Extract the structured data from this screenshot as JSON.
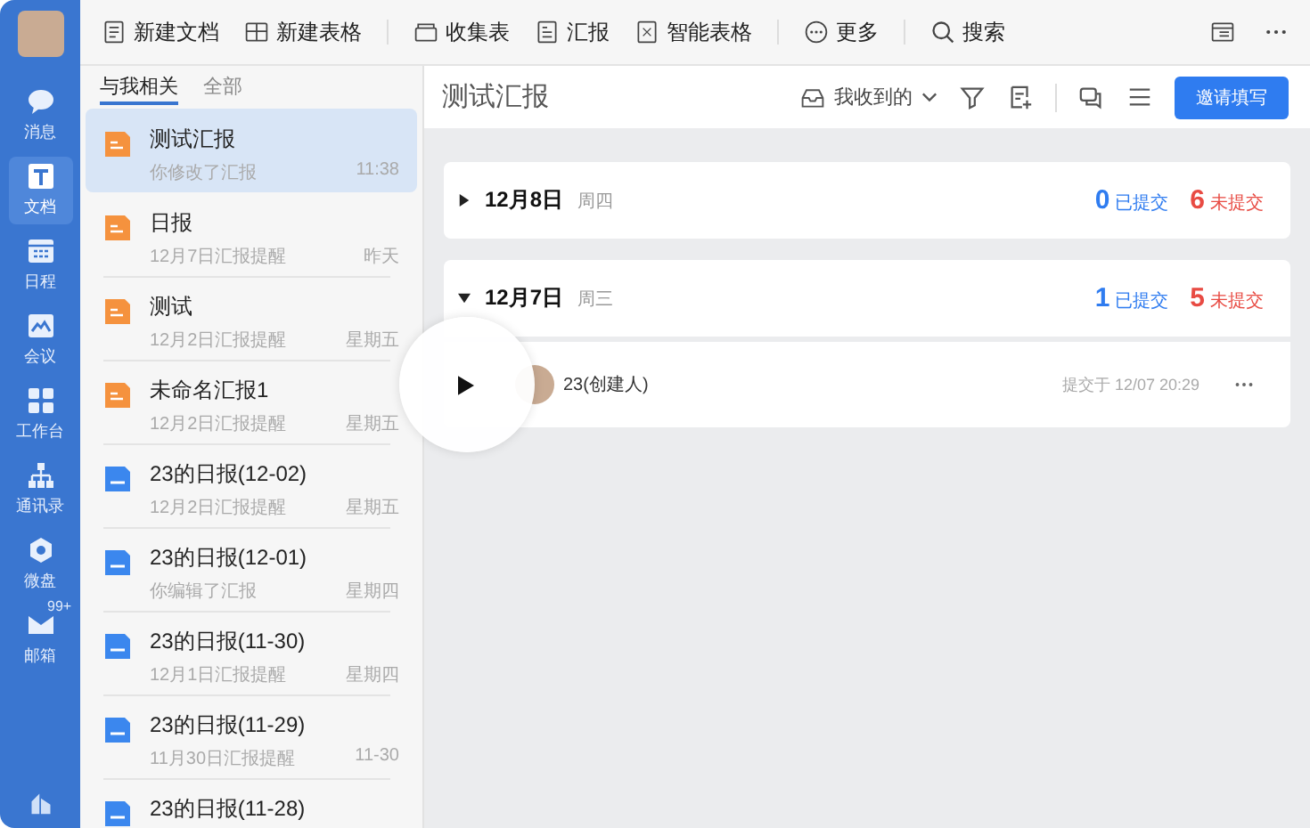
{
  "sidebar": {
    "items": [
      {
        "label": "消息",
        "selected": false
      },
      {
        "label": "文档",
        "selected": true
      },
      {
        "label": "日程",
        "selected": false
      },
      {
        "label": "会议",
        "selected": false
      },
      {
        "label": "工作台",
        "selected": false
      },
      {
        "label": "通讯录",
        "selected": false
      },
      {
        "label": "微盘",
        "selected": false
      },
      {
        "label": "邮箱",
        "selected": false,
        "badge": "99+"
      }
    ]
  },
  "toolbar": {
    "items": [
      {
        "label": "新建文档"
      },
      {
        "label": "新建表格"
      },
      {
        "label": "收集表"
      },
      {
        "label": "汇报"
      },
      {
        "label": "智能表格"
      },
      {
        "label": "更多"
      },
      {
        "label": "搜索"
      }
    ]
  },
  "list": {
    "tabs": [
      {
        "label": "与我相关",
        "selected": true
      },
      {
        "label": "全部",
        "selected": false
      }
    ],
    "items": [
      {
        "kind": "report",
        "title": "测试汇报",
        "subtitle": "你修改了汇报",
        "time": "11:38",
        "selected": true
      },
      {
        "kind": "report",
        "title": "日报",
        "subtitle": "12月7日汇报提醒",
        "time": "昨天",
        "selected": false
      },
      {
        "kind": "report",
        "title": "测试",
        "subtitle": "12月2日汇报提醒",
        "time": "星期五",
        "selected": false
      },
      {
        "kind": "report",
        "title": "未命名汇报1",
        "subtitle": "12月2日汇报提醒",
        "time": "星期五",
        "selected": false
      },
      {
        "kind": "doc",
        "title": "23的日报(12-02)",
        "subtitle": "12月2日汇报提醒",
        "time": "星期五",
        "selected": false
      },
      {
        "kind": "doc",
        "title": "23的日报(12-01)",
        "subtitle": "你编辑了汇报",
        "time": "星期四",
        "selected": false
      },
      {
        "kind": "doc",
        "title": "23的日报(11-30)",
        "subtitle": "12月1日汇报提醒",
        "time": "星期四",
        "selected": false
      },
      {
        "kind": "doc",
        "title": "23的日报(11-29)",
        "subtitle": "11月30日汇报提醒",
        "time": "11-30",
        "selected": false
      },
      {
        "kind": "doc",
        "title": "23的日报(11-28)",
        "selected": false
      }
    ]
  },
  "detail": {
    "title": "测试汇报",
    "filter": "我收到的",
    "invite_button": "邀请填写",
    "days": [
      {
        "date": "12月8日",
        "weekday": "周四",
        "expanded": false,
        "submitted_count": "0",
        "submitted_label": "已提交",
        "pending_count": "6",
        "pending_label": "未提交"
      },
      {
        "date": "12月7日",
        "weekday": "周三",
        "expanded": true,
        "submitted_count": "1",
        "submitted_label": "已提交",
        "pending_count": "5",
        "pending_label": "未提交",
        "entries": [
          {
            "name": "23(创建人)",
            "time": "提交于 12/07 20:29"
          }
        ]
      }
    ]
  }
}
